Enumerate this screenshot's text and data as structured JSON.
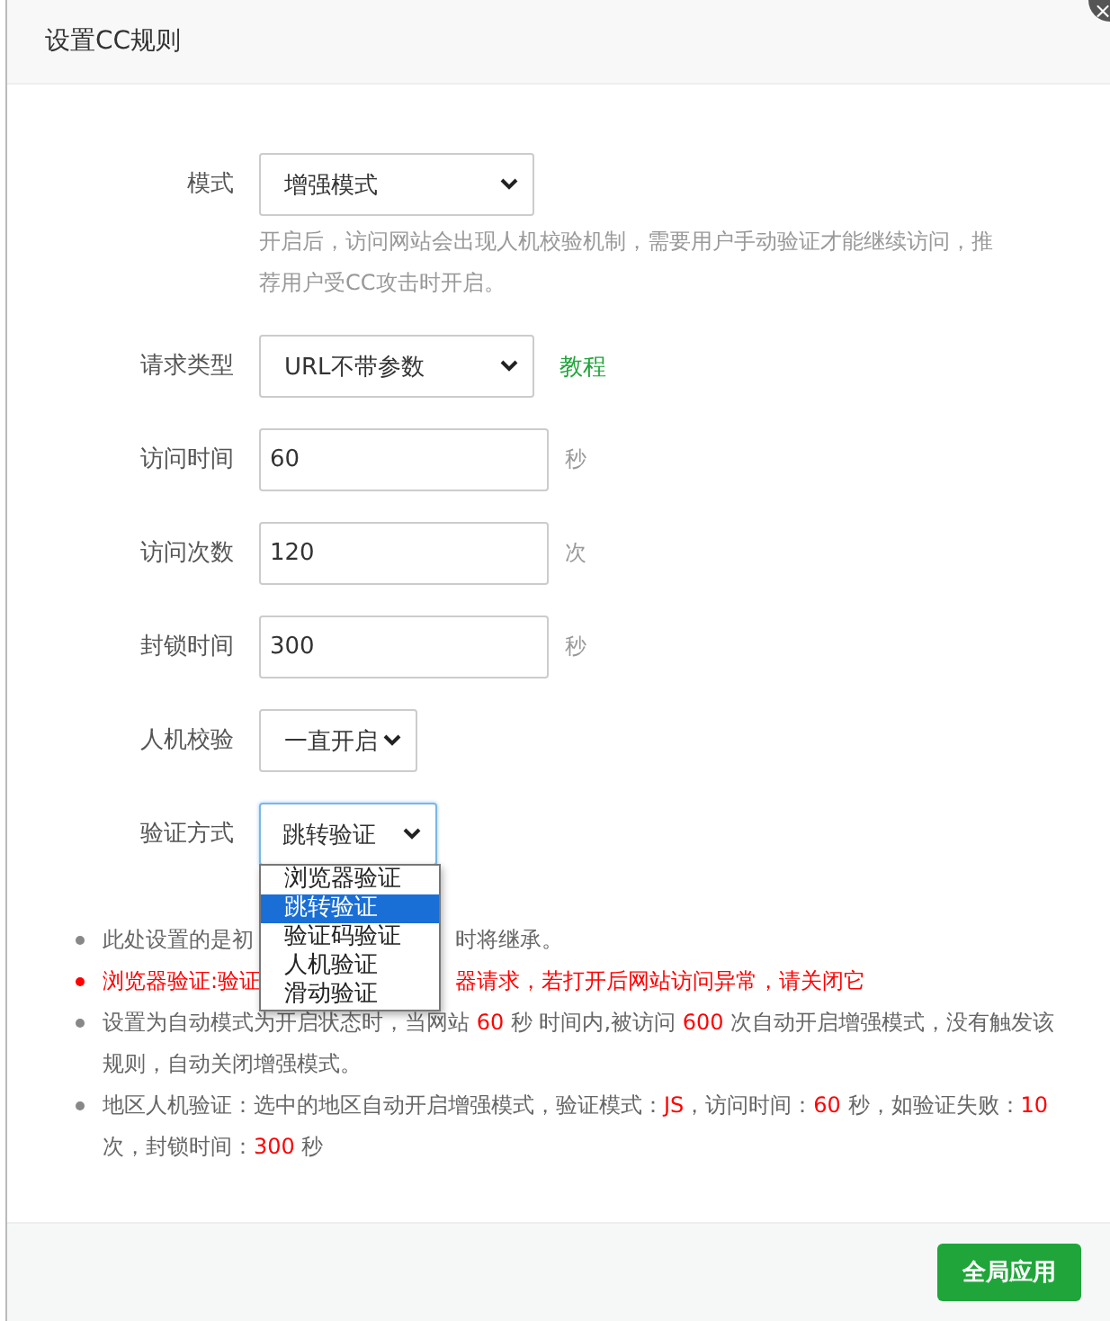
{
  "window": {
    "title": "设置CC规则",
    "close": "×"
  },
  "form": [
    {
      "label": "模式",
      "kind": "select",
      "value": "增强模式",
      "description": "开启后，访问网站会出现人机校验机制，需要用户手动验证才能继续访问，推荐用户受CC攻击时开启。"
    },
    {
      "label": "请求类型",
      "kind": "select",
      "value": "URL不带参数",
      "link": "教程"
    },
    {
      "label": "访问时间",
      "kind": "input",
      "value": "60",
      "unit": "秒"
    },
    {
      "label": "访问次数",
      "kind": "input",
      "value": "120",
      "unit": "次"
    },
    {
      "label": "封锁时间",
      "kind": "input",
      "value": "300",
      "unit": "秒"
    },
    {
      "label": "人机校验",
      "kind": "select",
      "value": "一直开启"
    },
    {
      "label": "验证方式",
      "kind": "select",
      "value": "跳转验证",
      "focused": true,
      "options": [
        {
          "label": "浏览器验证",
          "selected": false
        },
        {
          "label": "跳转验证",
          "selected": true
        },
        {
          "label": "验证码验证",
          "selected": false
        },
        {
          "label": "人机验证",
          "selected": false
        },
        {
          "label": "滑动验证",
          "selected": false
        }
      ]
    }
  ],
  "notes": [
    {
      "kind": "normal",
      "before": "此处设置的是初",
      "after": "时将继承。"
    },
    {
      "kind": "warning",
      "before": "浏览器验证:验证",
      "after": "器请求，若打开后网站访问异常，请关闭它"
    },
    {
      "kind": "normal",
      "parts": [
        {
          "text": "设置为自动模式为开启状态时，当网站 ",
          "highlight": false
        },
        {
          "text": "60",
          "highlight": true
        },
        {
          "text": " 秒 时间内,被访问 ",
          "highlight": false
        },
        {
          "text": "600",
          "highlight": true
        },
        {
          "text": " 次自动开启增强模式，没有触发该规则，自动关闭增强模式。",
          "highlight": false
        }
      ]
    },
    {
      "kind": "normal",
      "parts": [
        {
          "text": "地区人机验证：选中的地区自动开启增强模式，验证模式：",
          "highlight": false
        },
        {
          "text": "JS",
          "highlight": true
        },
        {
          "text": "，访问时间：",
          "highlight": false
        },
        {
          "text": "60",
          "highlight": true
        },
        {
          "text": " 秒，如验证失败：",
          "highlight": false
        },
        {
          "text": "10",
          "highlight": true
        },
        {
          "text": " 次，封锁时间：",
          "highlight": false
        },
        {
          "text": "300",
          "highlight": true
        },
        {
          "text": " 秒",
          "highlight": false
        }
      ]
    }
  ],
  "footer": {
    "button": "全局应用"
  }
}
